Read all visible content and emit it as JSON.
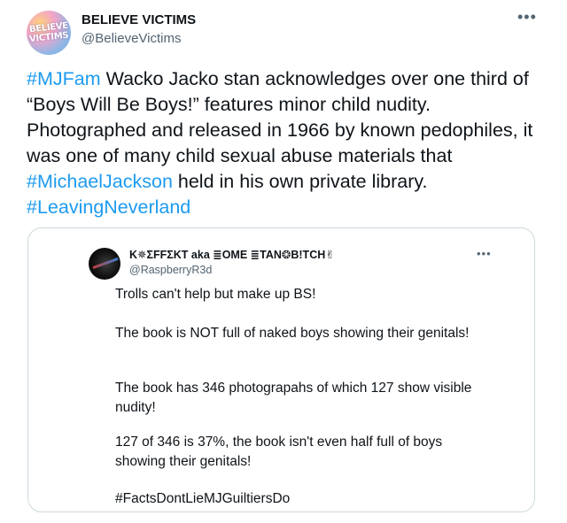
{
  "tweet": {
    "display_name": "BELIEVE VICTIMS",
    "handle": "@BelieveVictims",
    "avatar_text_line1": "BELIEVE",
    "avatar_text_line2": "VICTIMS",
    "more_icon": "•••",
    "text": {
      "tag1": "#MJFam",
      "part1": " Wacko Jacko stan acknowledges over one third of “Boys Will Be Boys!” features minor child nudity. Photographed and released in 1966 by known pedophiles, it was one of many child sexual abuse materials that ",
      "tag2": "#MichaelJackson",
      "part2": " held in his own private library. ",
      "tag3": "#LeavingNeverland"
    }
  },
  "quoted": {
    "display_name": "K✵ΣFFΣKT aka ≣OME ≣TAN❂B!TCH✌",
    "handle": "@RaspberryR3d",
    "more_icon": "•••",
    "paragraphs": [
      "Trolls can't help but make up BS!",
      "The book is NOT full of naked boys showing their genitals!",
      "The book has 346 photograpahs of which 127 show visible nudity!",
      "127 of 346 is 37%, the book isn't even half full of boys showing their genitals!",
      "#FactsDontLieMJGuiltiersDo"
    ]
  },
  "colors": {
    "link": "#1d9bf0",
    "text": "#0f1419",
    "secondary": "#536471",
    "border": "#cfd9de"
  }
}
